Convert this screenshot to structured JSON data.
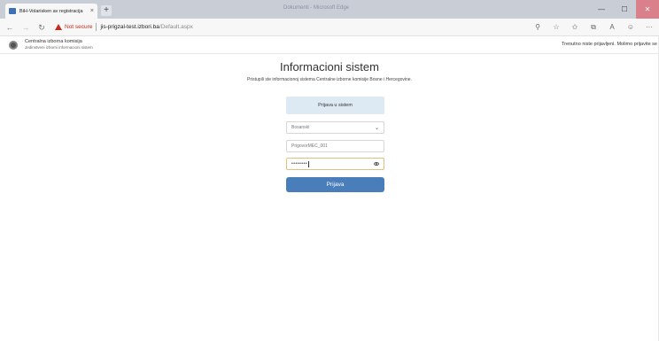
{
  "browser": {
    "tab_title": "BiH-Volarisken av registracija",
    "tab_close": "×",
    "new_tab": "+",
    "window_title": "Dokumenti - Microsoft Edge",
    "nav": {
      "back": "←",
      "forward": "→",
      "refresh": "↻"
    },
    "security_label": "Not secure",
    "url_host": "jis-prigzal-test.izbori.ba",
    "url_path": "/Default.aspx",
    "toolbar_icons": [
      "zoom-icon",
      "star-icon",
      "favorites-icon",
      "collections-icon",
      "read-aloud-icon",
      "profile-icon",
      "more-icon"
    ],
    "toolbar_glyphs": {
      "zoom": "⚲",
      "star": "☆",
      "favorites": "✩",
      "collections": "⧉",
      "read": "A",
      "profile": "☺",
      "more": "···"
    },
    "window_controls": {
      "minimize": "—",
      "maximize": "☐",
      "close": "✕"
    }
  },
  "header": {
    "org_name": "Centralna izborna komisija",
    "org_sub": "Jedinstveni izborni informacioni sistem",
    "login_note": "Trenutno niste prijavljeni. Molimo prijavite se"
  },
  "main": {
    "title": "Informacioni sistem",
    "subtitle": "Pristupili ste informacionoj sistema Centralne izborne komisije Bosne i Hercegovine.",
    "login_panel_label": "Prijava u sistem",
    "language_select": {
      "value": "Bosanski",
      "chevron": "⌄"
    },
    "username_field": {
      "value": "PrigovorMEC_001"
    },
    "password_field": {
      "value": "••••••••"
    },
    "submit_label": "Prijava"
  },
  "colors": {
    "primary": "#4a7ebb",
    "panel_bg": "#dde9f3",
    "warning": "#c42b1c"
  }
}
